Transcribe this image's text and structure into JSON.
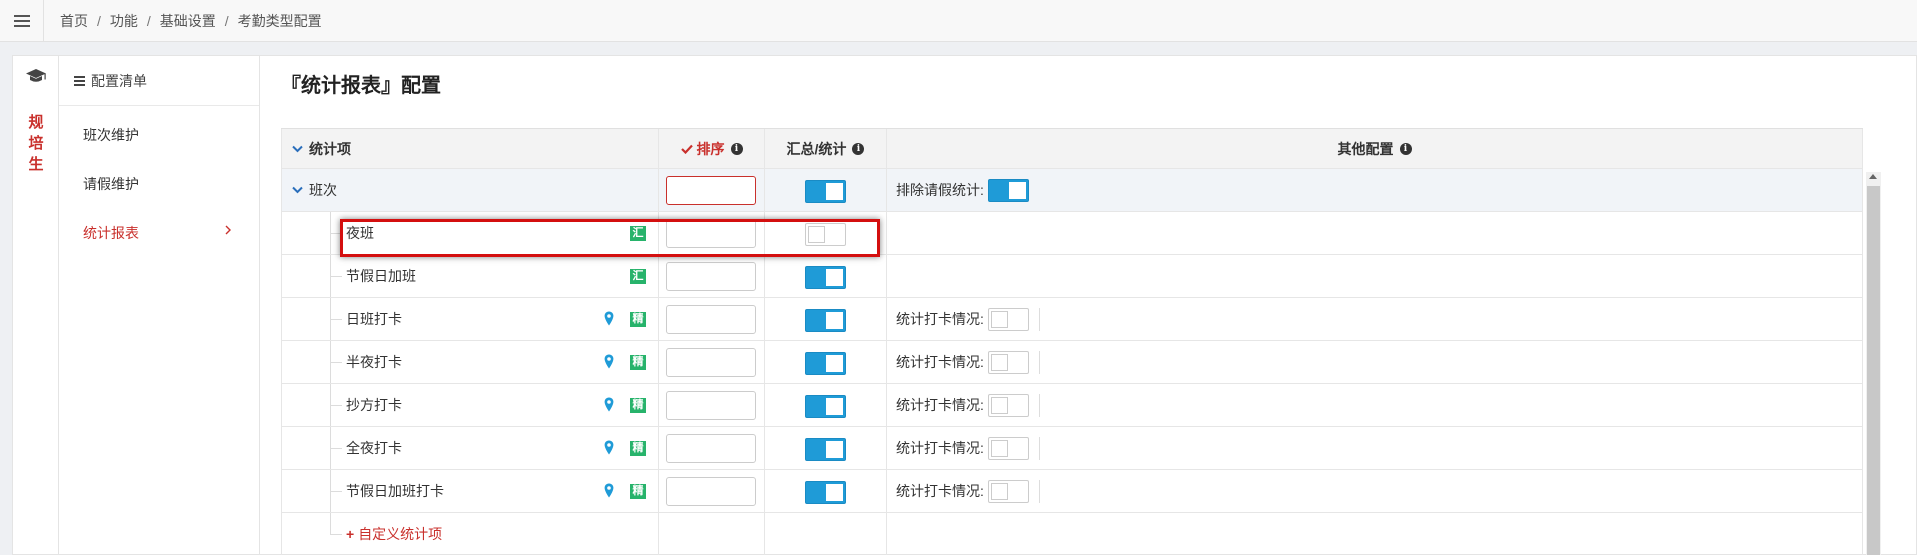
{
  "breadcrumb": [
    "首页",
    "功能",
    "基础设置",
    "考勤类型配置"
  ],
  "rail": {
    "label_lines": [
      "规",
      "培",
      "生"
    ]
  },
  "nav": {
    "header": "配置清单",
    "items": [
      {
        "label": "班次维护",
        "active": false
      },
      {
        "label": "请假维护",
        "active": false
      },
      {
        "label": "统计报表",
        "active": true
      }
    ]
  },
  "page_title": "『统计报表』配置",
  "table": {
    "headers": {
      "item": "统计项",
      "sort": "排序",
      "sum": "汇总/统计",
      "other": "其他配置"
    },
    "group": {
      "name": "班次",
      "sort_value": "",
      "sum_on": true,
      "other_label": "排除请假统计:",
      "other_on": true
    },
    "rows": [
      {
        "name": "夜班",
        "badge": "汇",
        "pin": false,
        "sort_value": "",
        "sum_on": false,
        "other_label": "",
        "other_on": false
      },
      {
        "name": "节假日加班",
        "badge": "汇",
        "pin": false,
        "sort_value": "",
        "sum_on": true,
        "other_label": "",
        "other_on": false
      },
      {
        "name": "日班打卡",
        "badge": "精",
        "pin": true,
        "sort_value": "",
        "sum_on": true,
        "other_label": "统计打卡情况:",
        "other_on": false
      },
      {
        "name": "半夜打卡",
        "badge": "精",
        "pin": true,
        "sort_value": "",
        "sum_on": true,
        "other_label": "统计打卡情况:",
        "other_on": false
      },
      {
        "name": "抄方打卡",
        "badge": "精",
        "pin": true,
        "sort_value": "",
        "sum_on": true,
        "other_label": "统计打卡情况:",
        "other_on": false
      },
      {
        "name": "全夜打卡",
        "badge": "精",
        "pin": true,
        "sort_value": "",
        "sum_on": true,
        "other_label": "统计打卡情况:",
        "other_on": false
      },
      {
        "name": "节假日加班打卡",
        "badge": "精",
        "pin": true,
        "sort_value": "",
        "sum_on": true,
        "other_label": "统计打卡情况:",
        "other_on": false
      }
    ],
    "add_label": "自定义统计项"
  },
  "colors": {
    "accent_red": "#c9302c",
    "toggle_on": "#1f9bd7",
    "badge_green": "#27b36b",
    "highlight": "#d40f0f"
  }
}
